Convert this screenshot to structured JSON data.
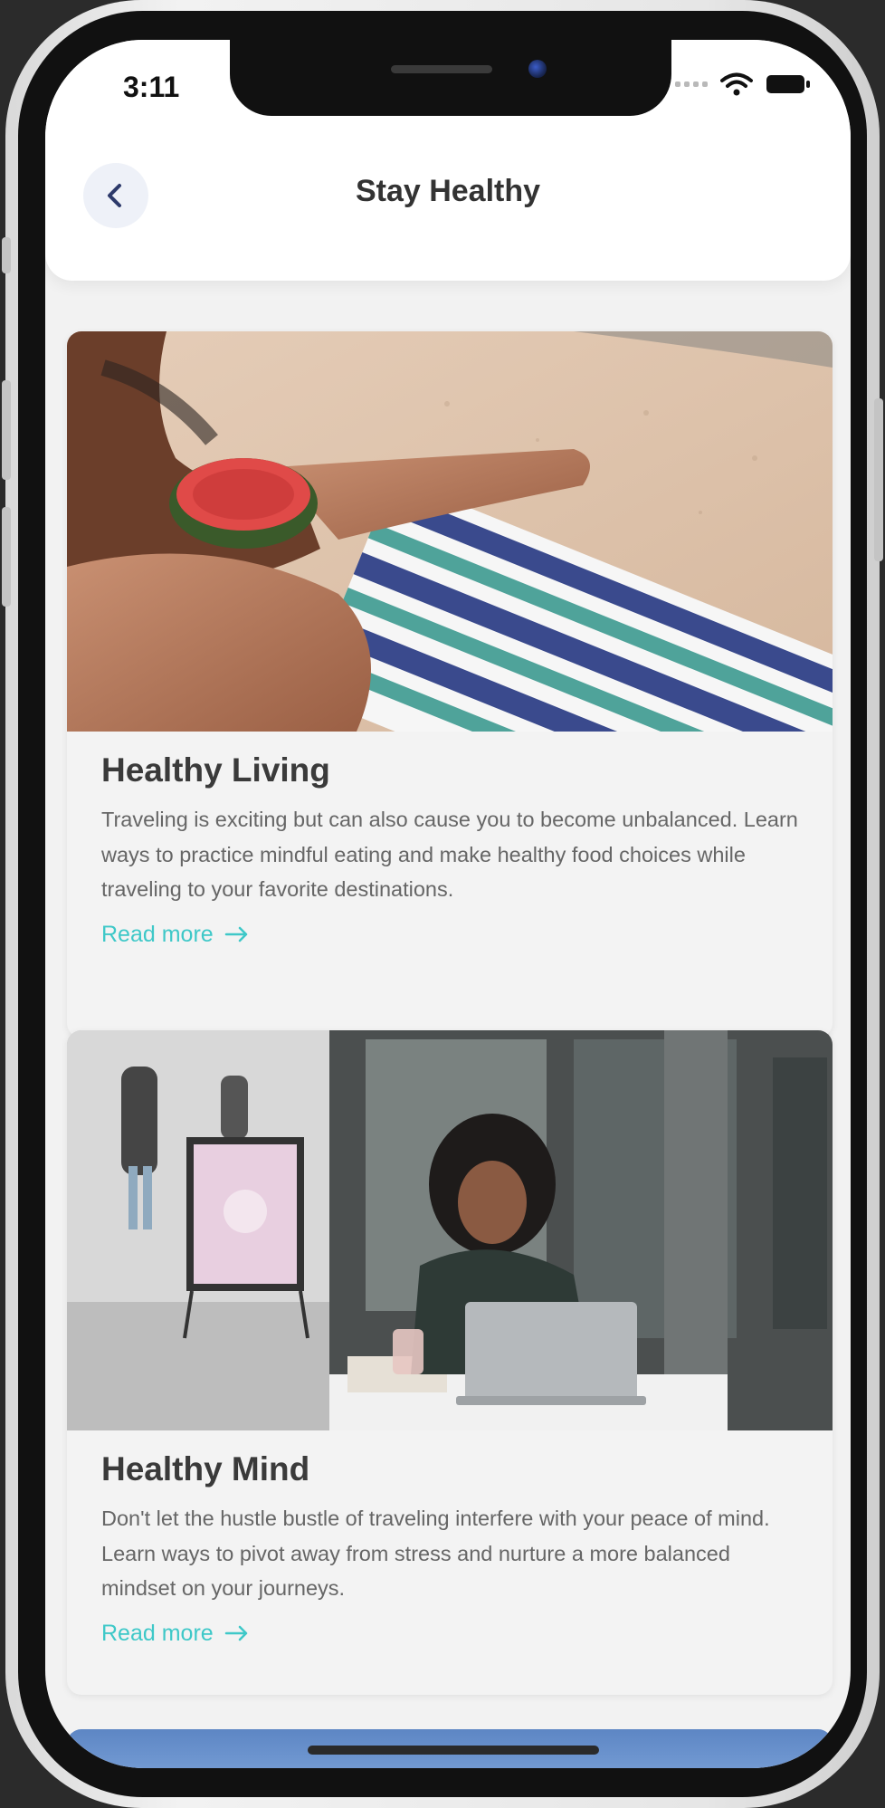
{
  "status_bar": {
    "time": "3:11",
    "icons": [
      "signal-dots-icon",
      "wifi-icon",
      "battery-icon"
    ]
  },
  "header": {
    "title": "Stay Healthy",
    "back_icon": "chevron-left-icon"
  },
  "cards": [
    {
      "title": "Healthy Living",
      "description": "Traveling is exciting but can also cause you to become unbalanced. Learn ways to practice mindful eating and make healthy food choices while traveling to your favorite destinations.",
      "link_label": "Read more",
      "link_icon": "arrow-right-icon"
    },
    {
      "title": "Healthy Mind",
      "description": "Don't let the hustle bustle of traveling interfere with your peace of mind. Learn ways to pivot away from stress and nurture a more balanced mindset on your journeys.",
      "link_label": "Read more",
      "link_icon": "arrow-right-icon"
    }
  ],
  "colors": {
    "accent": "#3ec8c8",
    "title_text": "#333333",
    "body_text": "#666666",
    "background": "#f2f2f2",
    "back_button_bg": "#eef1f8"
  }
}
